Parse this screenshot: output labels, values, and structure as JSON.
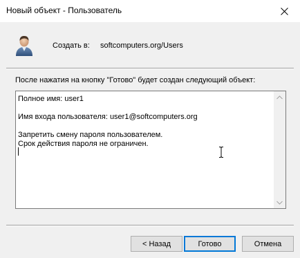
{
  "window": {
    "title": "Новый объект - Пользователь",
    "close_icon": "close-icon"
  },
  "header": {
    "icon": "user-icon",
    "create_in_label": "Создать в:",
    "create_in_path": "softcomputers.org/Users"
  },
  "description": "После нажатия на кнопку \"Готово\" будет создан следующий объект:",
  "summary": {
    "lines": [
      "Полное имя: user1",
      "",
      "Имя входа пользователя: user1@softcomputers.org",
      "",
      "Запретить смену пароля пользователем.",
      "Срок действия пароля не ограничен."
    ]
  },
  "buttons": {
    "back": "< Назад",
    "finish": "Готово",
    "cancel": "Отмена"
  },
  "colors": {
    "dialog_bg": "#f0f0f0",
    "default_button_border": "#0078d7"
  }
}
